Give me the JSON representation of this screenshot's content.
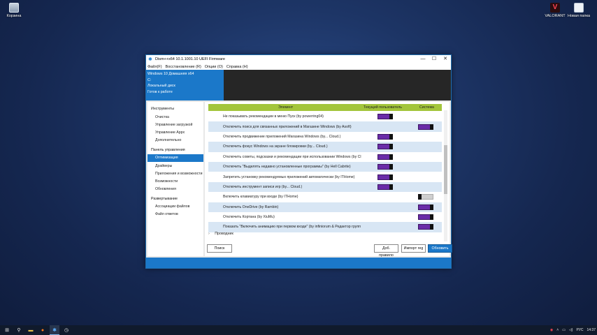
{
  "desktop": {
    "icons": [
      {
        "label": "Корзина",
        "icon": "recycle-bin-icon"
      },
      {
        "label": "VALORANT",
        "icon": "valorant-icon"
      },
      {
        "label": "Новая папка",
        "icon": "folder-icon"
      }
    ]
  },
  "window": {
    "title": "Dism++x64 10.1.1001.10 UEFI Firmware",
    "controls": {
      "minimize": "—",
      "maximize": "☐",
      "close": "✕"
    },
    "menu": [
      "Файл(F)",
      "Восстановление (R)",
      "Опции (O)",
      "Справка (H)"
    ],
    "banner": {
      "line1": "Windows 10 Домашняя x64",
      "line2": "C:",
      "line3": "Локальный диск",
      "line4": "Готов к работе"
    }
  },
  "sidebar": {
    "section1": "Инструменты",
    "tools": [
      "Очистка",
      "Управление загрузкой",
      "Управление Appx",
      "Дополнительно"
    ],
    "section2": "Панель управления",
    "control": [
      "Оптимизация",
      "Драйверы",
      "Приложения и возможности",
      "Возможности",
      "Обновления"
    ],
    "section3": "Развертывание",
    "deploy": [
      "Ассоциации файлов",
      "Файл ответов"
    ]
  },
  "grid": {
    "headers": {
      "element": "Элемент",
      "user": "Текущий пользователь",
      "system": "Система"
    },
    "rows": [
      {
        "text": "Не показывать рекомендации в меню Пуск (by powerring04)",
        "user": "on",
        "system": ""
      },
      {
        "text": "Отключить поиск для связанных приложений в Магазине Windows (by Asoft)",
        "user": "",
        "system": "on"
      },
      {
        "text": "Отключить продвижение приложений Магазина Windows (by... Cloud.)",
        "user": "on",
        "system": ""
      },
      {
        "text": "Отключить фокус Windows на экране блокировки (by... Cloud.)",
        "user": "on",
        "system": ""
      },
      {
        "text": "Отключить советы, подсказки и рекомендации при использовании Windows (by Cl",
        "user": "on",
        "system": ""
      },
      {
        "text": "Отключить \"Выделять недавно установленные программы\" (by Hell Cabrite)",
        "user": "on",
        "system": ""
      },
      {
        "text": "Запретить установку рекомендуемых приложений автоматически (by ITHome)",
        "user": "on",
        "system": ""
      },
      {
        "text": "Отключить инструмент записи игр (by... Cloud.)",
        "user": "on",
        "system": ""
      },
      {
        "text": "Включить клавиатуру при входе (by ITHome)",
        "user": "",
        "system": "off"
      },
      {
        "text": "Отключить OneDrive (by Rambin)",
        "user": "",
        "system": "on"
      },
      {
        "text": "Отключить Кортана (by XiuMu)",
        "user": "",
        "system": "on"
      },
      {
        "text": "Показать \"Включить анимацию при первом входе\" (by infiniorum & Редактор групп",
        "user": "",
        "system": "on"
      }
    ],
    "group": "Проводник"
  },
  "buttons": {
    "search": "Поиск",
    "add_rule": "Доб. правило",
    "import_reg": "Импорт reg",
    "refresh": "Обновить"
  },
  "taskbar": {
    "icons": [
      "windows-start-icon",
      "search-icon",
      "file-explorer-icon",
      "firefox-icon",
      "dism-icon",
      "clock-app-icon"
    ],
    "lang": "РУС",
    "time": "14:37"
  },
  "colors": {
    "accent": "#1b78c9",
    "header_green": "#a3c53b",
    "toggle_on": "#6a2ca8"
  }
}
